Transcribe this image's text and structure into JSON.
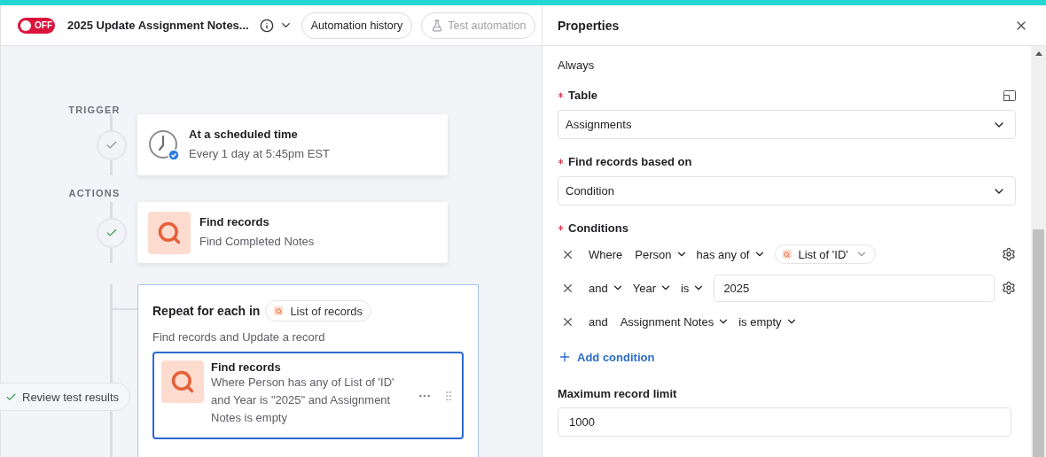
{
  "toolbar": {
    "toggle": {
      "label": "OFF",
      "on": false
    },
    "title": "2025 Update Assignment Notes...",
    "buttons": [
      {
        "label": "Automation history",
        "disabled": false
      },
      {
        "label": "Test automation",
        "disabled": true
      }
    ]
  },
  "flow": {
    "trigger_heading": "TRIGGER",
    "trigger": {
      "title": "At a scheduled time",
      "subtitle": "Every 1 day at 5:45pm EST",
      "passed": false
    },
    "actions_heading": "ACTIONS",
    "action": {
      "title": "Find records",
      "subtitle": "Find Completed Notes",
      "passed": true
    },
    "repeat": {
      "title": "Repeat for each in",
      "source": "List of records",
      "description": "Find records and Update a record",
      "selected": true,
      "step": {
        "title": "Find records",
        "description": "Where Person has any of List of 'ID' and Year is \"2025\" and Assignment Notes is empty",
        "selected": true
      }
    },
    "review_button": "Review test results"
  },
  "properties": {
    "title": "Properties",
    "run_value": "Always",
    "table": {
      "label": "Table",
      "required": true,
      "value": "Assignments"
    },
    "find_based_on": {
      "label": "Find records based on",
      "required": true,
      "value": "Condition"
    },
    "conditions": {
      "label": "Conditions",
      "required": true,
      "rows": [
        {
          "settings": true,
          "parts": [
            {
              "kind": "text",
              "label": "Where"
            },
            {
              "kind": "dropdown",
              "label": "Person"
            },
            {
              "kind": "dropdown",
              "label": "has any of"
            },
            {
              "kind": "token",
              "label": "List of 'ID'"
            }
          ]
        },
        {
          "settings": true,
          "parts": [
            {
              "kind": "dropdown",
              "label": "and"
            },
            {
              "kind": "dropdown",
              "label": "Year"
            },
            {
              "kind": "dropdown",
              "label": "is"
            },
            {
              "kind": "input",
              "label": "2025"
            }
          ]
        },
        {
          "settings": false,
          "parts": [
            {
              "kind": "text",
              "label": "and"
            },
            {
              "kind": "dropdown",
              "label": "Assignment Notes"
            },
            {
              "kind": "dropdown",
              "label": "is empty"
            }
          ]
        }
      ]
    },
    "add_condition": "Add condition",
    "limit": {
      "label": "Maximum record limit",
      "required": false,
      "value": "1000"
    }
  }
}
